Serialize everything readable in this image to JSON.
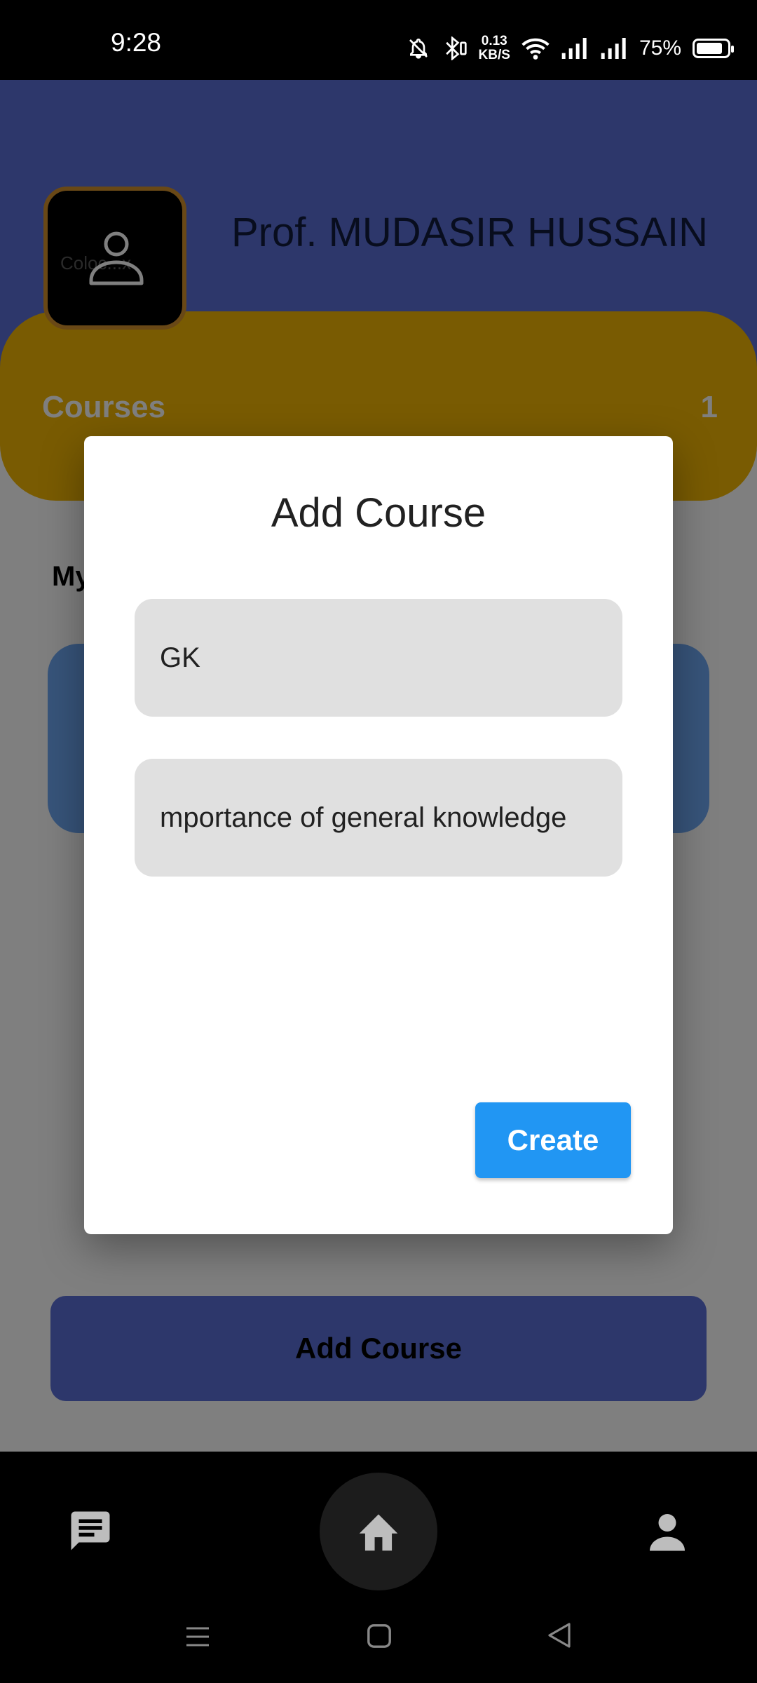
{
  "status_bar": {
    "time": "9:28",
    "speed_value": "0.13",
    "speed_unit": "KB/S",
    "battery_pct": "75%",
    "battery_level": 0.75,
    "icons": [
      "bell-off-icon",
      "bluetooth-icon",
      "wifi-icon",
      "signal-icon",
      "signal-icon",
      "battery-icon"
    ]
  },
  "header": {
    "avatar_text": "Coloc...x",
    "name": "Prof. MUDASIR HUSSAIN"
  },
  "stats": {
    "courses_label": "Courses",
    "courses_count": "1"
  },
  "content": {
    "section_heading_partial": "My"
  },
  "add_course_button": "Add Course",
  "dialog": {
    "title": "Add Course",
    "field_name_value": "GK",
    "field_description_value": "mportance of general knowledge",
    "create_label": "Create"
  },
  "bottom_nav": {
    "items": [
      "chat-icon",
      "home-icon",
      "profile-icon"
    ],
    "system": [
      "menu-icon",
      "square-home-icon",
      "back-icon"
    ]
  },
  "colors": {
    "header": "#5b6fd6",
    "courses_card": "#f2b705",
    "course_item": "#6fa8f5",
    "create_button": "#2196f3",
    "avatar_border": "#d2912c"
  }
}
